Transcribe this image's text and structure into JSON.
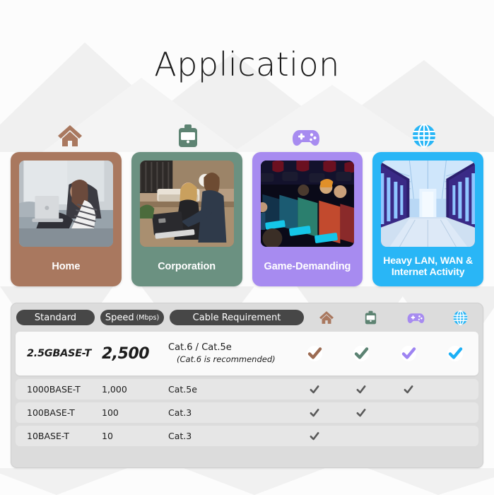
{
  "page": {
    "title": "Application",
    "background_color": "#fcfcfc"
  },
  "categories": [
    {
      "id": "home",
      "icon": "house-icon",
      "label": "Home",
      "color": "#a9785f",
      "check_color": "#9c6b52"
    },
    {
      "id": "corporation",
      "icon": "briefcase-icon",
      "label": "Corporation",
      "color": "#6b9181",
      "check_color": "#5c8373"
    },
    {
      "id": "gaming",
      "icon": "gamepad-icon",
      "label": "Game-Demanding",
      "color": "#a78bf0",
      "check_color": "#9e84f2"
    },
    {
      "id": "network",
      "icon": "globe-icon",
      "label": "Heavy LAN, WAN &\nInternet Activity",
      "color": "#29b6f6",
      "check_color": "#1cb0f6"
    }
  ],
  "table": {
    "headers": {
      "standard": "Standard",
      "speed": "Speed",
      "speed_unit": "(Mbps)",
      "cable": "Cable Requirement"
    },
    "header_icons": [
      "house-icon",
      "briefcase-icon",
      "gamepad-icon",
      "globe-icon"
    ],
    "gray_check_color": "#5a5a5a",
    "rows": [
      {
        "standard": "2.5GBASE-T",
        "speed": "2,500",
        "cable": "Cat.6 / Cat.5e",
        "cable_note": "(Cat.6 is recommended)",
        "highlight": true,
        "checks": [
          true,
          true,
          true,
          true
        ]
      },
      {
        "standard": "1000BASE-T",
        "speed": "1,000",
        "cable": "Cat.5e",
        "cable_note": "",
        "highlight": false,
        "checks": [
          true,
          true,
          true,
          false
        ]
      },
      {
        "standard": "100BASE-T",
        "speed": "100",
        "cable": "Cat.3",
        "cable_note": "",
        "highlight": false,
        "checks": [
          true,
          true,
          false,
          false
        ]
      },
      {
        "standard": "10BASE-T",
        "speed": "10",
        "cable": "Cat.3",
        "cable_note": "",
        "highlight": false,
        "checks": [
          true,
          false,
          false,
          false
        ]
      }
    ]
  }
}
